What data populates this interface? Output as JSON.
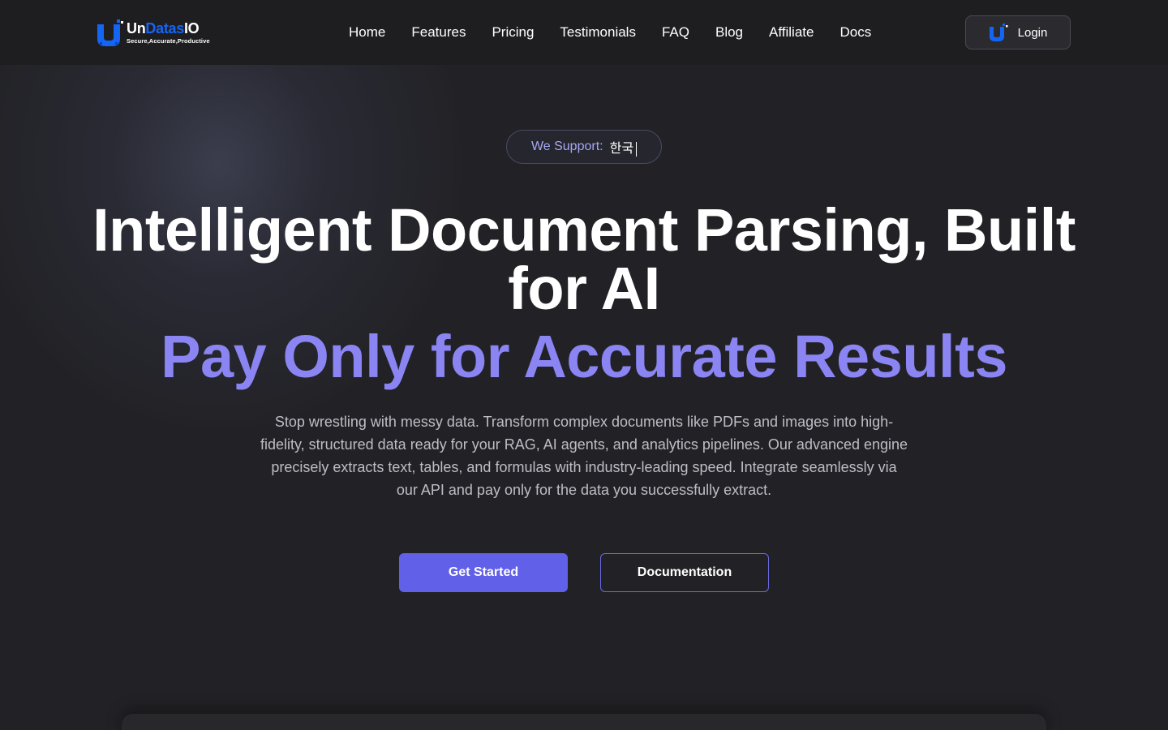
{
  "header": {
    "logo": {
      "name_un": "Un",
      "name_datas": "Datas",
      "name_io": "IO",
      "tagline": "Secure,Accurate,Productive"
    },
    "nav": [
      {
        "label": "Home"
      },
      {
        "label": "Features"
      },
      {
        "label": "Pricing"
      },
      {
        "label": "Testimonials"
      },
      {
        "label": "FAQ"
      },
      {
        "label": "Blog"
      },
      {
        "label": "Affiliate"
      },
      {
        "label": "Docs"
      }
    ],
    "login_label": "Login"
  },
  "support": {
    "label": "We Support:",
    "language": "한국"
  },
  "hero": {
    "title": "Intelligent Document Parsing, Built for AI",
    "subtitle": "Pay Only for Accurate Results",
    "description": "Stop wrestling with messy data. Transform complex documents like PDFs and images into high-fidelity, structured data ready for your RAG, AI agents, and analytics pipelines. Our advanced engine precisely extracts text, tables, and formulas with industry-leading speed. Integrate seamlessly via our API and pay only for the data you successfully extract.",
    "primary_button": "Get Started",
    "secondary_button": "Documentation"
  },
  "colors": {
    "accent": "#6160e8",
    "accent_text": "#8a85f2",
    "logo_blue": "#1565f5",
    "background": "#222226"
  }
}
